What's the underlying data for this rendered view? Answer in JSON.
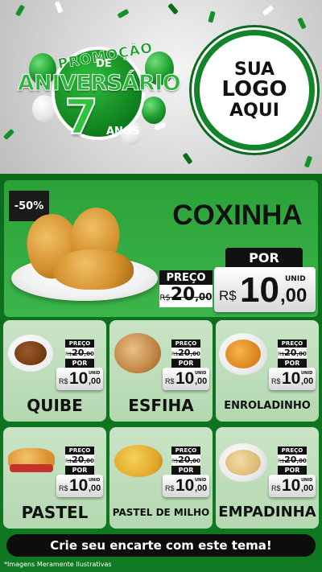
{
  "header": {
    "badge": {
      "promo": "PROMOÇÃO",
      "de": "DE",
      "aniversario": "ANIVERSÁRIO",
      "number": "7",
      "anos": "ANOS"
    },
    "logo": {
      "line1": "SUA",
      "line2": "LOGO",
      "line3": "AQUI"
    }
  },
  "featured": {
    "discount": "-50%",
    "name": "COXINHA",
    "preco_label": "PREÇO",
    "old_price_currency": "R$",
    "old_price_int": "20",
    "old_price_cents": ",00",
    "por_label": "POR",
    "unid_label": "UNID",
    "new_price_currency": "R$",
    "new_price_int": "10",
    "new_price_cents": ",00"
  },
  "products": [
    {
      "name": "QUIBE",
      "preco_label": "PREÇO",
      "old_currency": "R$",
      "old_int": "20",
      "old_cents": ",00",
      "por_label": "POR",
      "unid_label": "UNID",
      "new_currency": "R$",
      "new_int": "10",
      "new_cents": ",00"
    },
    {
      "name": "ESFIHA",
      "preco_label": "PREÇO",
      "old_currency": "R$",
      "old_int": "20",
      "old_cents": ",00",
      "por_label": "POR",
      "unid_label": "UNID",
      "new_currency": "R$",
      "new_int": "10",
      "new_cents": ",00"
    },
    {
      "name": "ENROLADINHO",
      "preco_label": "PREÇO",
      "old_currency": "R$",
      "old_int": "20",
      "old_cents": ",00",
      "por_label": "POR",
      "unid_label": "UNID",
      "new_currency": "R$",
      "new_int": "10",
      "new_cents": ",00"
    },
    {
      "name": "PASTEL",
      "preco_label": "PREÇO",
      "old_currency": "R$",
      "old_int": "20",
      "old_cents": ",00",
      "por_label": "POR",
      "unid_label": "UNID",
      "new_currency": "R$",
      "new_int": "10",
      "new_cents": ",00"
    },
    {
      "name": "PASTEL DE MILHO",
      "preco_label": "PREÇO",
      "old_currency": "R$",
      "old_int": "20",
      "old_cents": ",00",
      "por_label": "POR",
      "unid_label": "UNID",
      "new_currency": "R$",
      "new_int": "10",
      "new_cents": ",00"
    },
    {
      "name": "EMPADINHA",
      "preco_label": "PREÇO",
      "old_currency": "R$",
      "old_int": "20",
      "old_cents": ",00",
      "por_label": "POR",
      "unid_label": "UNID",
      "new_currency": "R$",
      "new_int": "10",
      "new_cents": ",00"
    }
  ],
  "cta": {
    "label": "Crie seu encarte com este tema!"
  },
  "footer": {
    "disclaimer": "*Imagens Meramente Ilustrativas"
  },
  "colors": {
    "brand_green": "#12842a",
    "panel_green": "#0f7a22",
    "hero_green": "#3cb54a",
    "card_bg": "#c9e4c6",
    "tag_black": "#111111"
  }
}
